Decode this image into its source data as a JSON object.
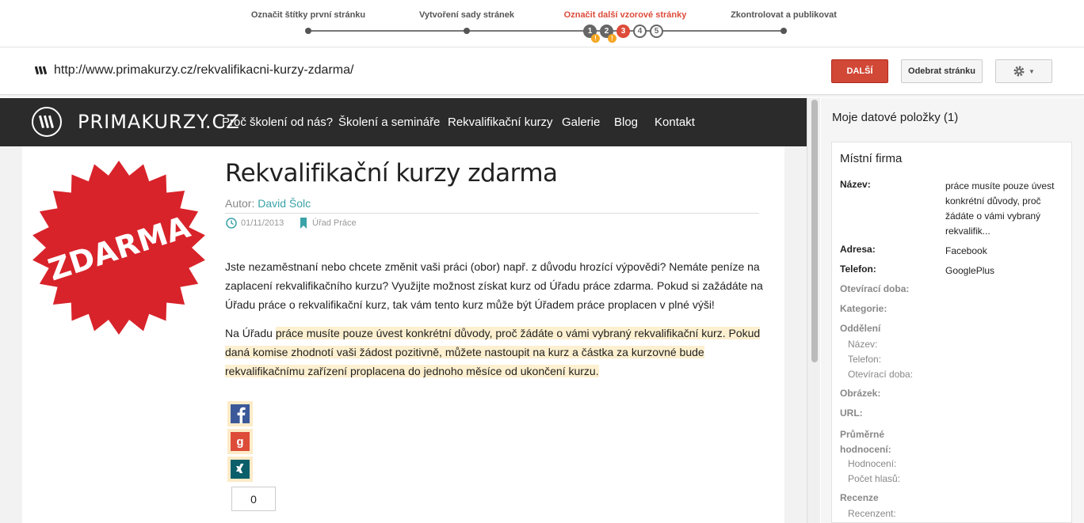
{
  "steps": [
    {
      "label": "Označit štítky první stránku",
      "state": "done"
    },
    {
      "label": "Vytvoření sady stránek",
      "state": "done"
    },
    {
      "label": "Označit další vzorové stránky",
      "state": "active"
    },
    {
      "label": "Zkontrolovat a publikovat",
      "state": "todo"
    }
  ],
  "sub_steps": [
    "1",
    "2",
    "3",
    "4",
    "5"
  ],
  "url": "http://www.primakurzy.cz/rekvalifikacni-kurzy-zdarma/",
  "buttons": {
    "next": "DALŠÍ",
    "remove": "Odebrat stránku"
  },
  "site": {
    "logo": "PRIMAKURZY.CZ",
    "nav": [
      "Proč školení od nás?",
      "Školení a semináře",
      "Rekvalifikační kurzy",
      "Galerie",
      "Blog",
      "Kontakt"
    ],
    "badge": "ZDARMA",
    "title": "Rekvalifikační kurzy zdarma",
    "author_prefix": "Autor:",
    "author": "David Šolc",
    "date": "01/11/2013",
    "category": "Úřad Práce",
    "para1": "Jste nezaměstnaní nebo chcete změnit vaši práci (obor) např. z důvodu hrozící výpovědi? Nemáte peníze na zaplacení rekvalifikačního kurzu? Využijte možnost získat kurz od Úřadu práce zdarma. Pokud si zažádáte na Úřadu práce o rekvalifikační kurz, tak vám tento kurz může být Úřadem práce proplacen v plné výši!",
    "para2_plain": "Na Úřadu ",
    "para2_hl": "práce musíte pouze úvest konkrétní důvody, proč žádáte o vámi vybraný rekvalifikační kurz. Pokud daná komise zhodnotí vaši žádost pozitivně, můžete nastoupit na kurz a částka za kurzovné bude rekvalifikačnímu zařízení proplacena do jednoho měsíce od ukončení kurzu.",
    "share_count": "0"
  },
  "panel": {
    "title": "Moje datové položky (1)",
    "card_title": "Místní firma",
    "fields": [
      {
        "label": "Název:",
        "value": "práce musíte pouze úvest konkrétní důvody, proč žádáte o vámi vybraný rekvalifik...",
        "style": "b"
      },
      {
        "label": "Adresa:",
        "value": "Facebook",
        "style": "b"
      },
      {
        "label": "Telefon:",
        "value": "GooglePlus",
        "style": "b"
      },
      {
        "label": "Otevírací doba:",
        "value": "",
        "style": "g"
      },
      {
        "label": "Kategorie:",
        "value": "",
        "style": "g"
      },
      {
        "label": "Oddělení",
        "value": "",
        "style": "g"
      },
      {
        "label": "Název:",
        "value": "",
        "style": "sub"
      },
      {
        "label": "Telefon:",
        "value": "",
        "style": "sub"
      },
      {
        "label": "Otevírací doba:",
        "value": "",
        "style": "sub"
      },
      {
        "label": "Obrázek:",
        "value": "",
        "style": "g"
      },
      {
        "label": "URL:",
        "value": "",
        "style": "g"
      },
      {
        "label": "Průměrné hodnocení:",
        "value": "",
        "style": "g"
      },
      {
        "label": "Hodnocení:",
        "value": "",
        "style": "sub"
      },
      {
        "label": "Počet hlasů:",
        "value": "",
        "style": "sub"
      },
      {
        "label": "Recenze",
        "value": "",
        "style": "g"
      },
      {
        "label": "Recenzent:",
        "value": "",
        "style": "sub"
      }
    ]
  },
  "colors": {
    "accent": "#dd4b39",
    "highlight": "#fdf0d0",
    "link": "#3aa3a8",
    "nav_bg": "#2b2b2b",
    "badge": "#d8232a"
  }
}
